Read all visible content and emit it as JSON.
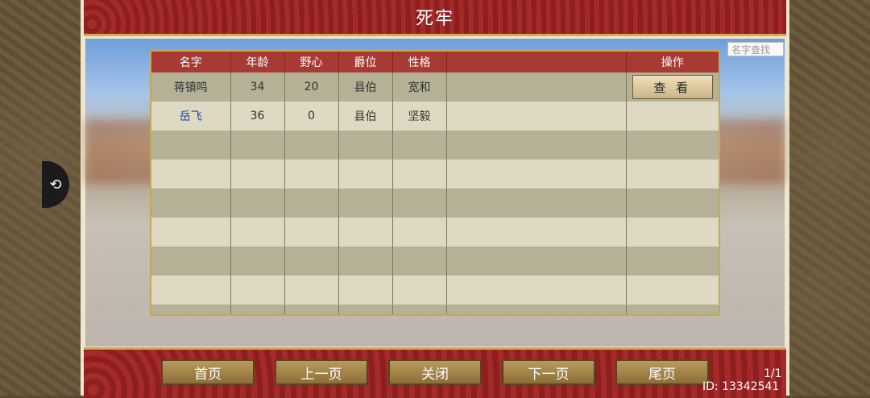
{
  "title": "死牢",
  "search": {
    "placeholder": "名字查找"
  },
  "table": {
    "headers": [
      "名字",
      "年龄",
      "野心",
      "爵位",
      "性格",
      "",
      "操作"
    ],
    "rows": [
      {
        "name": "蒋镇鸣",
        "age": "34",
        "ambition": "20",
        "rank": "县伯",
        "personality": "宽和",
        "action": "查 看"
      },
      {
        "name": "岳飞",
        "age": "36",
        "ambition": "0",
        "rank": "县伯",
        "personality": "坚毅",
        "action": ""
      }
    ]
  },
  "nav": {
    "first": "首页",
    "prev": "上一页",
    "close": "关闭",
    "next": "下一页",
    "last": "尾页"
  },
  "page_indicator": "1/1",
  "user_id": "ID: 13342541",
  "colors": {
    "header_red": "#a83a34",
    "row_odd": "#b4b196",
    "row_even": "#ddd9c2",
    "name_blue": "#1c3fa8"
  }
}
